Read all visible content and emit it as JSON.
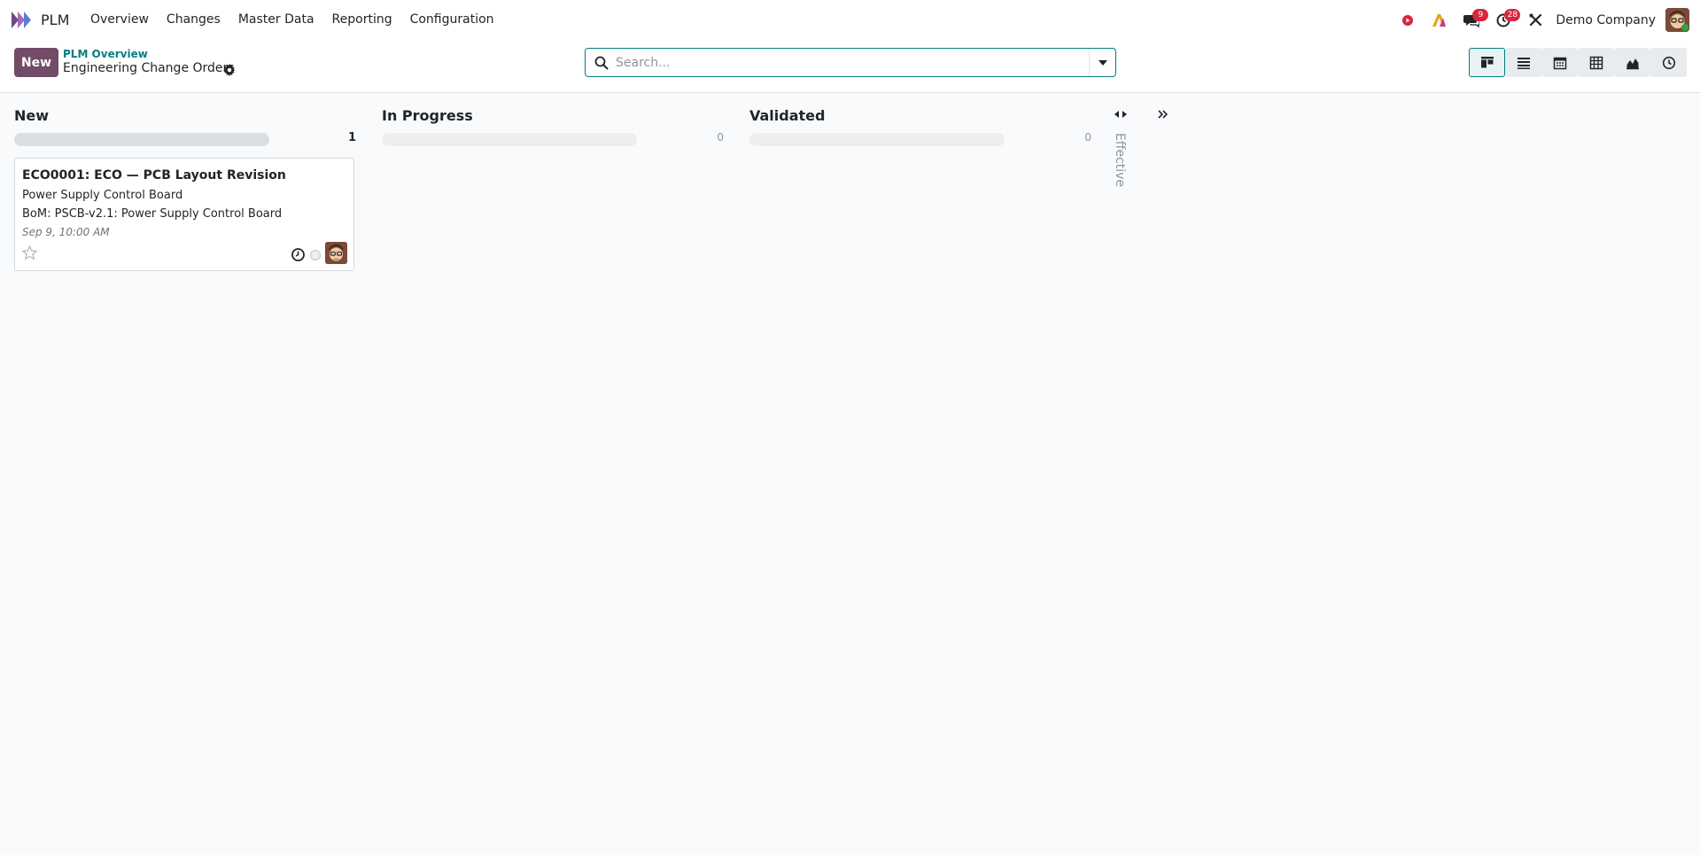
{
  "app": {
    "name": "PLM"
  },
  "menu": {
    "items": [
      "Overview",
      "Changes",
      "Master Data",
      "Reporting",
      "Configuration"
    ]
  },
  "systray": {
    "messages_badge": "9",
    "activities_badge": "28",
    "company": "Demo Company"
  },
  "control": {
    "new_label": "New",
    "breadcrumb_parent": "PLM Overview",
    "breadcrumb_current": "Engineering Change Orders",
    "search_placeholder": "Search..."
  },
  "views": [
    "kanban-view",
    "list-view",
    "calendar-view",
    "pivot-view",
    "graph-view",
    "activity-view"
  ],
  "columns": [
    {
      "title": "New",
      "count": "1",
      "progress": 1.0
    },
    {
      "title": "In Progress",
      "count": "0",
      "progress": 0
    },
    {
      "title": "Validated",
      "count": "0",
      "progress": 0
    }
  ],
  "folded_column": {
    "title": "Effective"
  },
  "card": {
    "title": "ECO0001: ECO — PCB Layout Revision",
    "product": "Power Supply Control Board",
    "bom": "BoM: PSCB-v2.1: Power Supply Control Board",
    "date": "Sep 9, 10:00 AM"
  },
  "colors": {
    "brand": "#714b67",
    "accent": "#017e84",
    "badge": "#d7263d"
  }
}
